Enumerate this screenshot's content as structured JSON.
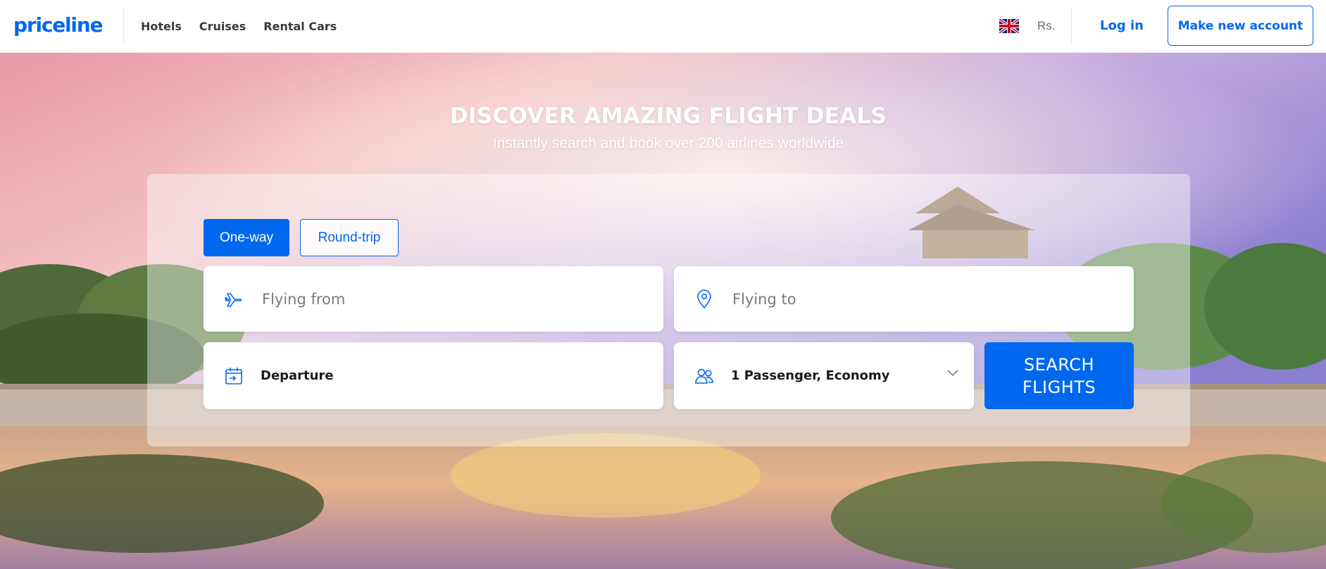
{
  "header": {
    "logo": "priceline",
    "nav": [
      "Hotels",
      "Cruises",
      "Rental Cars"
    ],
    "language_icon": "uk-flag-icon",
    "currency": "Rs.",
    "login_label": "Log in",
    "signup_label": "Make new account"
  },
  "hero": {
    "headline": "DISCOVER AMAZING FLIGHT DEALS",
    "subheadline": "Instantly search and book over 200 airlines worldwide"
  },
  "search": {
    "trip_types": [
      "One-way",
      "Round-trip"
    ],
    "selected_trip_type": "One-way",
    "from_placeholder": "Flying from",
    "from_icon": "airplane-icon",
    "to_placeholder": "Flying to",
    "to_icon": "location-pin-icon",
    "departure_label": "Departure",
    "departure_icon": "calendar-icon",
    "passengers_label": "1 Passenger, Economy",
    "passengers_icon": "people-icon",
    "search_button": "SEARCH FLIGHTS"
  },
  "colors": {
    "brand": "#0068ef",
    "white": "#ffffff"
  }
}
